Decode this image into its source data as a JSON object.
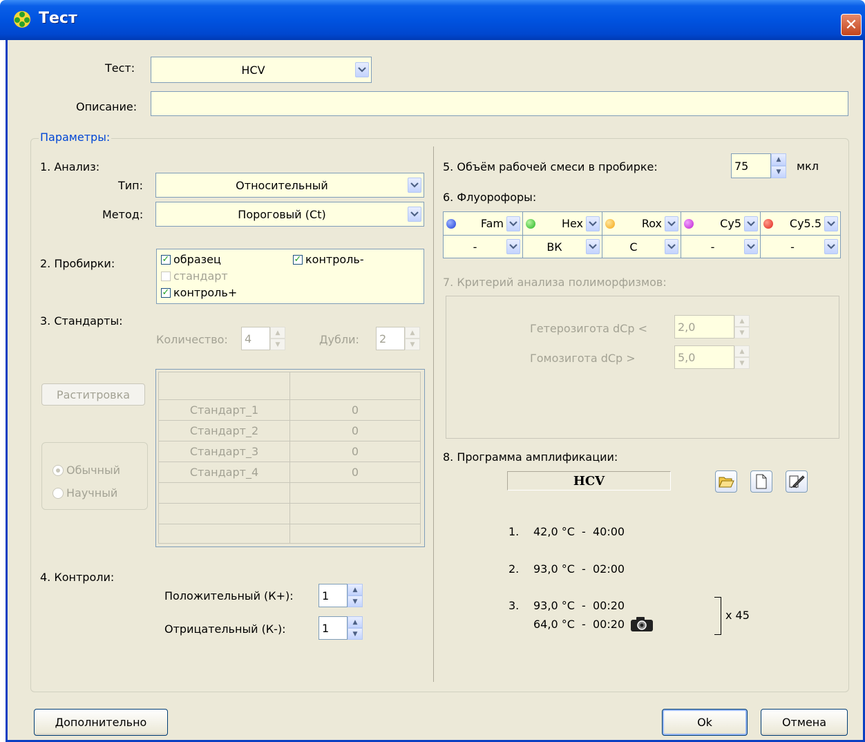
{
  "window": {
    "title": "Тест",
    "close": "✕"
  },
  "test": {
    "label": "Тест:",
    "value": "HCV"
  },
  "description": {
    "label": "Описание:",
    "value": ""
  },
  "params": {
    "title": "Параметры:"
  },
  "analysis": {
    "heading": "1. Анализ:",
    "type_label": "Тип:",
    "type_value": "Относительный",
    "method_label": "Метод:",
    "method_value": "Пороговый (Ct)"
  },
  "tubes": {
    "heading": "2. Пробирки:",
    "sample": "образец",
    "control_minus": "контроль-",
    "standard": "стандарт",
    "control_plus": "контроль+"
  },
  "standards": {
    "heading": "3. Стандарты:",
    "count_label": "Количество:",
    "count_value": "4",
    "dupl_label": "Дубли:",
    "dupl_value": "2",
    "rast_button": "Раститровка",
    "rows": [
      {
        "name": "Стандарт_1",
        "value": "0"
      },
      {
        "name": "Стандарт_2",
        "value": "0"
      },
      {
        "name": "Стандарт_3",
        "value": "0"
      },
      {
        "name": "Стандарт_4",
        "value": "0"
      }
    ],
    "radio_normal": "Обычный",
    "radio_scientific": "Научный"
  },
  "controls": {
    "heading": "4. Контроли:",
    "pos_label": "Положительный (К+):",
    "pos_value": "1",
    "neg_label": "Отрицательный (К-):",
    "neg_value": "1"
  },
  "volume": {
    "label": "5. Объём рабочей смеси в пробирке:",
    "value": "75",
    "unit": "мкл"
  },
  "fluoro": {
    "heading": "6. Флуорофоры:",
    "columns": [
      {
        "name": "Fam",
        "color": "#1f3fd8",
        "value": "-"
      },
      {
        "name": "Hex",
        "color": "#22b422",
        "value": "ВК"
      },
      {
        "name": "Rox",
        "color": "#f5a614",
        "value": "С"
      },
      {
        "name": "Cy5",
        "color": "#c020d0",
        "value": "-"
      },
      {
        "name": "Cy5.5",
        "color": "#e0261e",
        "value": "-"
      }
    ]
  },
  "poly": {
    "heading": "7. Критерий анализа полиморфизмов:",
    "het_label": "Гетерозигота dCp <",
    "het_value": "2,0",
    "hom_label": "Гомозигота dCp >",
    "hom_value": "5,0"
  },
  "program": {
    "heading": "8. Программа амплификации:",
    "name": "HCV",
    "step1_num": "1.",
    "step1": "42,0 °C  -  40:00",
    "step2_num": "2.",
    "step2": "93,0 °C  -  02:00",
    "step3_num": "3.",
    "step3a": "93,0 °C  -  00:20",
    "step3b": "64,0 °C  -  00:20",
    "repeat": "x 45"
  },
  "buttons": {
    "extra": "Дополнительно",
    "ok": "Ok",
    "cancel": "Отмена"
  }
}
